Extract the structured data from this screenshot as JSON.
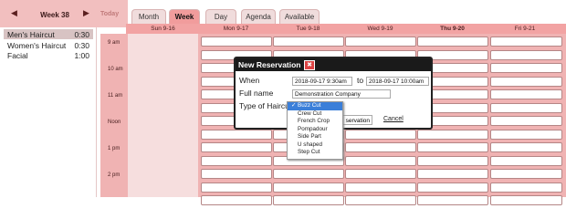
{
  "nav": {
    "prev_icon": "◀",
    "week_label": "Week 38",
    "next_icon": "▶",
    "today_label": "Today"
  },
  "tabs": [
    {
      "label": "Month",
      "active": false
    },
    {
      "label": "Week",
      "active": true
    },
    {
      "label": "Day",
      "active": false
    },
    {
      "label": "Agenda",
      "active": false
    },
    {
      "label": "Available",
      "active": false
    }
  ],
  "services": [
    {
      "name": "Men's Haircut",
      "duration": "0:30",
      "selected": true
    },
    {
      "name": "Women's Haircut",
      "duration": "0:30",
      "selected": false
    },
    {
      "name": "Facial",
      "duration": "1:00",
      "selected": false
    }
  ],
  "days": [
    "Sun 9-16",
    "Mon 9-17",
    "Tue 9-18",
    "Wed 9-19",
    "Thu 9-20",
    "Fri 9-21"
  ],
  "times": [
    "9 am",
    "10 am",
    "11 am",
    "Noon",
    "1 pm",
    "2 pm"
  ],
  "dialog": {
    "title": "New Reservation",
    "close_icon": "✖",
    "when_label": "When",
    "start": "2018-09-17 9:30am",
    "to_label": "to",
    "end": "2018-09-17 10:00am",
    "name_label": "Full name",
    "name_value": "Demonstration Company",
    "type_label": "Type of Haircut",
    "save_label": "servation",
    "cancel_label": "Cancel"
  },
  "haircut_options": [
    {
      "label": "Buzz Cut",
      "selected": true
    },
    {
      "label": "Crew Cut",
      "selected": false
    },
    {
      "label": "French Crop",
      "selected": false
    },
    {
      "label": "Pompadour",
      "selected": false
    },
    {
      "label": "Side Part",
      "selected": false
    },
    {
      "label": "U shaped",
      "selected": false
    },
    {
      "label": "Step Cut",
      "selected": false
    }
  ],
  "colors": {
    "accent": "#f19c9c",
    "header": "#f2a3a3",
    "selection": "#3b7fd9"
  }
}
